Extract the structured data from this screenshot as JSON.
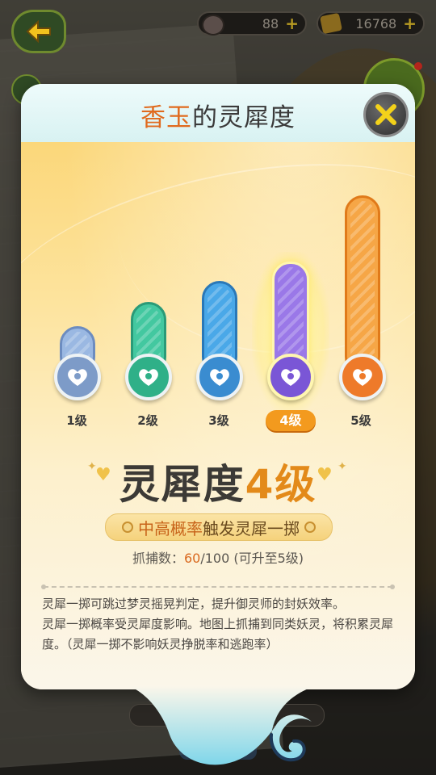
{
  "currency": {
    "stamina": "88",
    "gold": "16768"
  },
  "modal": {
    "title_name": "香玉",
    "title_suffix": "的灵犀度",
    "levels": [
      {
        "label": "1级",
        "color": "#9ab8e2"
      },
      {
        "label": "2级",
        "color": "#43c8a0"
      },
      {
        "label": "3级",
        "color": "#4aa8e8"
      },
      {
        "label": "4级",
        "color": "#9a78e8",
        "active": true
      },
      {
        "label": "5级",
        "color": "#f6a646"
      }
    ],
    "current_level_prefix": "灵犀度",
    "current_level_num": "4级",
    "effect_highlight": "中高概率",
    "effect_text": "触发灵犀一掷",
    "catch_label": "抓捕数：",
    "catch_current": "60",
    "catch_rest": "/100 (可升至5级)",
    "description": [
      "灵犀一掷可跳过梦灵摇晃判定，提升御灵师的封妖效率。",
      "灵犀一掷概率受灵犀度影响。地图上抓捕到同类妖灵，将积累灵犀度。（灵犀一掷不影响妖灵挣脱率和逃跑率）"
    ]
  }
}
